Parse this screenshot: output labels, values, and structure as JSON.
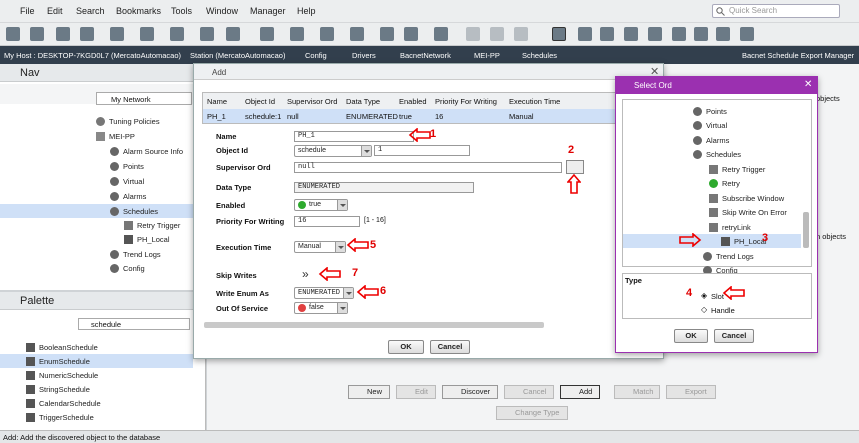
{
  "menu": [
    "File",
    "Edit",
    "Search",
    "Bookmarks",
    "Tools",
    "Window",
    "Manager",
    "Help"
  ],
  "search": {
    "placeholder": "Quick Search"
  },
  "path": {
    "host": "My Host : DESKTOP-7KGD0L7 (MercatoAutomacao)",
    "station": "Station (MercatoAutomacao)",
    "items": [
      "Config",
      "Drivers",
      "BacnetNetwork",
      "MEI-PP",
      "Schedules"
    ],
    "view": "Bacnet Schedule Export Manager"
  },
  "nav": {
    "title": "Nav",
    "root": "My Network",
    "items": [
      "Tuning Policies",
      "MEI-PP",
      "Alarm Source Info",
      "Points",
      "Virtual",
      "Alarms",
      "Schedules",
      "Retry Trigger",
      "PH_Local",
      "Trend Logs",
      "Config"
    ]
  },
  "palette": {
    "title": "Palette",
    "filter": "schedule",
    "items": [
      "BooleanSchedule",
      "EnumSchedule",
      "NumericSchedule",
      "StringSchedule",
      "CalendarSchedule",
      "TriggerSchedule"
    ]
  },
  "add": {
    "title": "Add",
    "columns": [
      "Name",
      "Object Id",
      "Supervisor Ord",
      "Data Type",
      "Enabled",
      "Priority For Writing",
      "Execution Time"
    ],
    "row": [
      "PH_1",
      "schedule:1",
      "null",
      "ENUMERATED",
      "true",
      "16",
      "Manual"
    ],
    "name_label": "Name",
    "name_value": "PH_1",
    "objid_label": "Object Id",
    "objid_type": "schedule",
    "objid_num": "1",
    "sup_label": "Supervisor Ord",
    "sup_value": "null",
    "dtype_label": "Data Type",
    "dtype_value": "ENUMERATED",
    "enabled_label": "Enabled",
    "enabled_value": "true",
    "prio_label": "Priority For Writing",
    "prio_value": "16",
    "prio_range": "[1 - 16]",
    "exec_label": "Execution Time",
    "exec_value": "Manual",
    "skip_label": "Skip Writes",
    "wea_label": "Write Enum As",
    "wea_value": "ENUMERATED",
    "oos_label": "Out Of Service",
    "oos_value": "false",
    "ok": "OK",
    "cancel": "Cancel"
  },
  "select": {
    "title": "Select Ord",
    "items": [
      "Points",
      "Virtual",
      "Alarms",
      "Schedules",
      "Retry Trigger",
      "Retry",
      "Subscribe Window",
      "Skip Write On Error",
      "retryLink",
      "PH_Local",
      "Trend Logs",
      "Config"
    ],
    "type_label": "Type",
    "slot": "Slot",
    "handle": "Handle",
    "ok": "OK",
    "cancel": "Cancel"
  },
  "annotations": [
    "1",
    "2",
    "3",
    "4",
    "5",
    "6",
    "7"
  ],
  "bottom": {
    "new": "New",
    "edit": "Edit",
    "discover": "Discover",
    "cancel": "Cancel",
    "add": "Add",
    "match": "Match",
    "export": "Export",
    "change_type": "Change Type"
  },
  "right": {
    "objects": "objects",
    "objects2": "n objects"
  },
  "status": "Add: Add the discovered object to the database"
}
